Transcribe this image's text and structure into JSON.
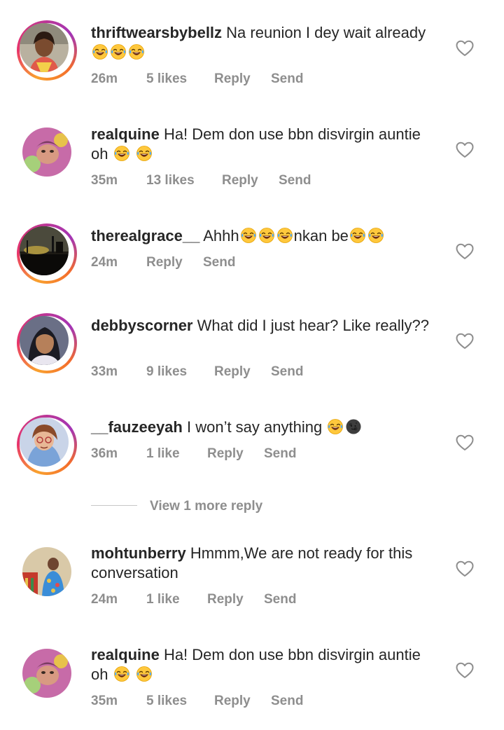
{
  "comments": [
    {
      "username": "thriftwearsbybellz",
      "text": "Na reunion I dey wait already",
      "emojis": [
        "laughing-tears",
        "laughing-tears",
        "laughing-tears"
      ],
      "time": "26m",
      "likes": "5 likes",
      "reply": "Reply",
      "send": "Send",
      "story_ring": true
    },
    {
      "username": "realquine",
      "text": "Ha! Dem don use bbn disvirgin auntie oh",
      "emojis": [
        "laughing-tears",
        "laughing-tears"
      ],
      "time": "35m",
      "likes": "13 likes",
      "reply": "Reply",
      "send": "Send",
      "story_ring": false
    },
    {
      "username": "therealgrace__",
      "text_part1": "Ahhh",
      "text_part2": "nkan be",
      "emojis": [
        "laughing-tears",
        "laughing-tears",
        "laughing-tears",
        "laughing-tears",
        "laughing-tears"
      ],
      "time": "24m",
      "reply": "Reply",
      "send": "Send",
      "story_ring": true
    },
    {
      "username": "debbyscorner",
      "text": "What did I just hear? Like really??",
      "time": "33m",
      "likes": "9 likes",
      "reply": "Reply",
      "send": "Send",
      "story_ring": true
    },
    {
      "username": "__fauzeeyah",
      "text": "I won’t say anything",
      "emojis": [
        "laughing-tears",
        "new-moon-face"
      ],
      "time": "36m",
      "likes": "1 like",
      "reply": "Reply",
      "send": "Send",
      "story_ring": true
    },
    {
      "username": "mohtunberry",
      "text": "Hmmm,We are not ready for this conversation",
      "time": "24m",
      "likes": "1 like",
      "reply": "Reply",
      "send": "Send",
      "story_ring": false
    },
    {
      "username": "realquine",
      "text": "Ha! Dem don use bbn disvirgin auntie oh",
      "emojis": [
        "laughing-tears",
        "laughing-tears"
      ],
      "time": "35m",
      "likes": "5 likes",
      "reply": "Reply",
      "send": "Send",
      "story_ring": false
    }
  ],
  "view_more_replies": "View 1 more reply",
  "icons": {
    "like": "heart-outline-icon"
  },
  "colors": {
    "text": "#262626",
    "meta": "#8e8e8e",
    "ring_gradient": [
      "#f9a12e",
      "#e8336b",
      "#a335b5"
    ]
  }
}
